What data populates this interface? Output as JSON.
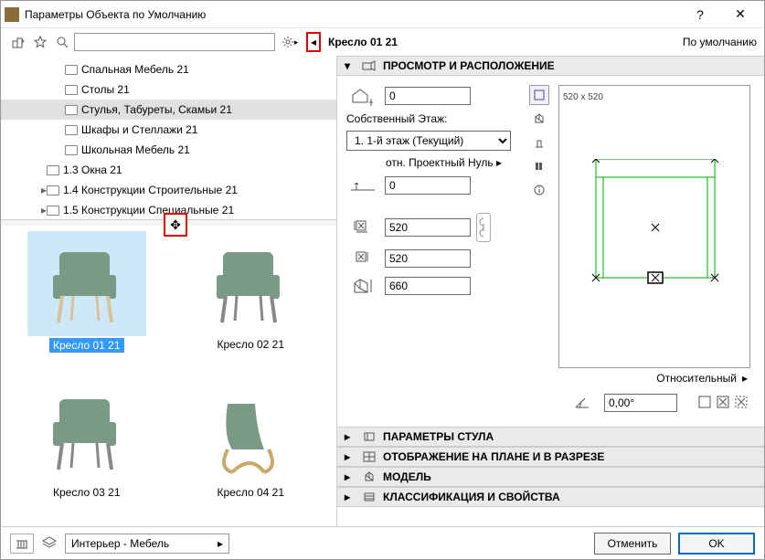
{
  "window": {
    "title": "Параметры Объекта по Умолчанию"
  },
  "header": {
    "objectName": "Кресло 01 21",
    "defaultLabel": "По умолчанию"
  },
  "tree": [
    {
      "label": "Спальная Мебель 21",
      "indent": 1,
      "arrow": "",
      "selected": false
    },
    {
      "label": "Столы 21",
      "indent": 1,
      "arrow": "",
      "selected": false
    },
    {
      "label": "Стулья, Табуреты, Скамьи 21",
      "indent": 1,
      "arrow": "",
      "selected": true
    },
    {
      "label": "Шкафы и Стеллажи 21",
      "indent": 1,
      "arrow": "",
      "selected": false
    },
    {
      "label": "Школьная Мебель 21",
      "indent": 1,
      "arrow": "",
      "selected": false
    },
    {
      "label": "1.3 Окна 21",
      "indent": 0,
      "arrow": "",
      "selected": false
    },
    {
      "label": "1.4 Конструкции Строительные 21",
      "indent": 0,
      "arrow": "▸",
      "selected": false
    },
    {
      "label": "1.5 Конструкции Специальные 21",
      "indent": 0,
      "arrow": "▸",
      "selected": false
    }
  ],
  "thumbs": [
    {
      "label": "Кресло 01 21",
      "selected": true
    },
    {
      "label": "Кресло 02 21",
      "selected": false
    },
    {
      "label": "Кресло 03 21",
      "selected": false
    },
    {
      "label": "Кресло 04 21",
      "selected": false
    }
  ],
  "sections": {
    "preview": "ПРОСМОТР И РАСПОЛОЖЕНИЕ",
    "chair": "ПАРАМЕТРЫ СТУЛА",
    "display": "ОТОБРАЖЕНИЕ НА ПЛАНЕ И В РАЗРЕЗЕ",
    "model": "МОДЕЛЬ",
    "class": "КЛАССИФИКАЦИЯ И СВОЙСТВА"
  },
  "position": {
    "elevation": "0",
    "ownFloorLabel": "Собственный Этаж:",
    "floor": "1. 1-й этаж (Текущий)",
    "relProjectZeroLabel": "отн. Проектный Нуль",
    "relProjectZero": "0",
    "width": "520",
    "depth": "520",
    "height": "660",
    "relativeLabel": "Относительный",
    "angle": "0,00°"
  },
  "preview": {
    "dims": "520 x 520"
  },
  "footer": {
    "layer": "Интерьер - Мебель",
    "cancel": "Отменить",
    "ok": "OK"
  }
}
